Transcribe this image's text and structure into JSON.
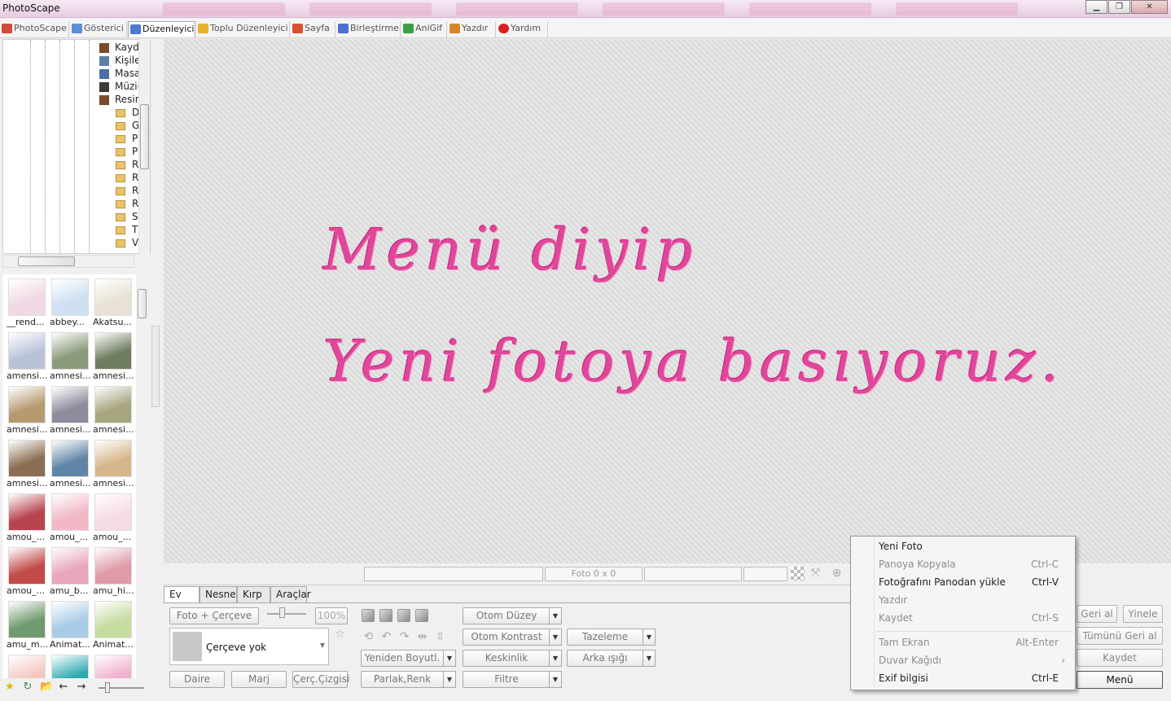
{
  "window": {
    "title": "PhotoScape",
    "minimize": "▁",
    "maximize": "❐",
    "close": "✕"
  },
  "tabs": [
    {
      "label": "PhotoScape",
      "icon": "photoscape-icon",
      "color": "#d04c3a"
    },
    {
      "label": "Gösterici",
      "icon": "viewer-icon",
      "color": "#5b8fd6"
    },
    {
      "label": "Düzenleyici",
      "icon": "editor-icon",
      "color": "#4c7ad0"
    },
    {
      "label": "Toplu Düzenleyici",
      "icon": "batch-editor-icon",
      "color": "#e8b12e"
    },
    {
      "label": "Sayfa",
      "icon": "page-icon",
      "color": "#d9502f"
    },
    {
      "label": "Birleştirme",
      "icon": "combine-icon",
      "color": "#4b6fd0"
    },
    {
      "label": "AniGif",
      "icon": "anigif-icon",
      "color": "#3d9e46"
    },
    {
      "label": "Yazdır",
      "icon": "print-icon",
      "color": "#d8862a"
    },
    {
      "label": "Yardım",
      "icon": "help-icon",
      "color": "#d42121"
    }
  ],
  "tree": {
    "nodes": [
      "Kayd",
      "Kişile",
      "Masa",
      "Müzi(",
      "Resir"
    ],
    "folders": [
      "D",
      "G",
      "P",
      "P",
      "R",
      "R",
      "R",
      "R",
      "S",
      "T",
      "V"
    ]
  },
  "thumbnails": [
    {
      "caption": "__rend...",
      "color": "#f0d9e4"
    },
    {
      "caption": "abbey...",
      "color": "#cfe0f2"
    },
    {
      "caption": "Akatsu...",
      "color": "#e8e2d5"
    },
    {
      "caption": "amensi...",
      "color": "#b9c3d8"
    },
    {
      "caption": "amnesi...",
      "color": "#8a9a7a"
    },
    {
      "caption": "amnesi...",
      "color": "#6f7d5f"
    },
    {
      "caption": "amnesi...",
      "color": "#b59a70"
    },
    {
      "caption": "amnesi...",
      "color": "#8c8c9c"
    },
    {
      "caption": "amnesi...",
      "color": "#a7a57f"
    },
    {
      "caption": "amnesi...",
      "color": "#8a6e52"
    },
    {
      "caption": "amnesi...",
      "color": "#5f86a6"
    },
    {
      "caption": "amnesi...",
      "color": "#d6b68a"
    },
    {
      "caption": "amou_...",
      "color": "#b84450"
    },
    {
      "caption": "amou_...",
      "color": "#f2b8c6"
    },
    {
      "caption": "amou_...",
      "color": "#f6dbe2"
    },
    {
      "caption": "amou_...",
      "color": "#c24a48"
    },
    {
      "caption": "amu_b...",
      "color": "#e8a6bc"
    },
    {
      "caption": "amu_hi...",
      "color": "#e09aa8"
    },
    {
      "caption": "amu_m...",
      "color": "#6f9a6e"
    },
    {
      "caption": "Animat...",
      "color": "#a9cce6"
    },
    {
      "caption": "Animat...",
      "color": "#c6dba0"
    },
    {
      "caption": "",
      "color": "#f3c7c2"
    },
    {
      "caption": "",
      "color": "#2ea9b0"
    },
    {
      "caption": "",
      "color": "#f0b0cf"
    }
  ],
  "left_tools": {
    "star": "★",
    "refresh": "↻",
    "folder": "📂",
    "back": "←",
    "forward": "→"
  },
  "canvas": {
    "line1": "Menü diyip",
    "line2": "Yeni fotoya basıyoruz."
  },
  "status": {
    "photo_size": "Foto 0 x 0"
  },
  "editor": {
    "tabs": [
      "Ev",
      "Nesne",
      "Kırp",
      "Araçlar"
    ],
    "frame_button": "Foto + Çerçeve",
    "zoom": "100%",
    "frame_select": "Çerçeve yok",
    "daire": "Daire",
    "marj": "Marj",
    "frame_line": "Çerç.Çizgisi",
    "otom_duzey": "Otom Düzey",
    "otom_kontrast": "Otom Kontrast",
    "tazeleme": "Tazeleme",
    "yeniden_boyut": "Yeniden Boyutl.",
    "keskinlik": "Keskinlik",
    "arka_isigi": "Arka ışığı",
    "parlak_renk": "Parlak,Renk",
    "filtre": "Filtre"
  },
  "actions": {
    "geri_al": "Geri al",
    "yinele": "Yinele",
    "tumunu_geri_al": "Tümünü Geri al",
    "kaydet": "Kaydet",
    "menu": "Menü"
  },
  "context_menu": [
    {
      "label": "Yeni Foto",
      "shortcut": "",
      "enabled": true
    },
    {
      "label": "Panoya Kopyala",
      "shortcut": "Ctrl-C",
      "enabled": false
    },
    {
      "label": "Fotoğrafını Panodan yükle",
      "shortcut": "Ctrl-V",
      "enabled": true
    },
    {
      "label": "Yazdır",
      "shortcut": "",
      "enabled": false
    },
    {
      "label": "Kaydet",
      "shortcut": "Ctrl-S",
      "enabled": false
    },
    {
      "label": "Tam Ekran",
      "shortcut": "Alt-Enter",
      "enabled": false
    },
    {
      "label": "Duvar Kağıdı",
      "shortcut": "›",
      "enabled": false
    },
    {
      "label": "Exif bilgisi",
      "shortcut": "Ctrl-E",
      "enabled": true
    }
  ]
}
